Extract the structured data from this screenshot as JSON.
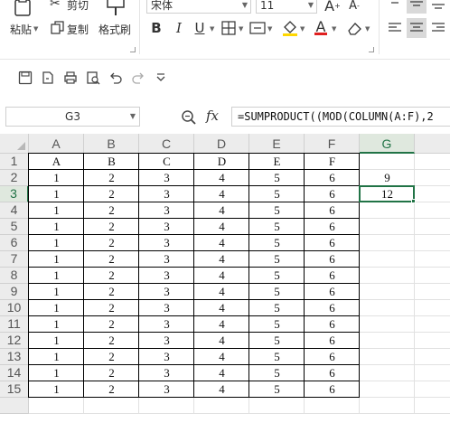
{
  "ribbon": {
    "paste_label": "粘贴",
    "cut_label": "剪切",
    "copy_label": "复制",
    "format_painter_label": "格式刷",
    "font_name": "宋体",
    "font_size": "11",
    "increase_font_label": "A",
    "decrease_font_label": "A",
    "bold_label": "B",
    "italic_label": "I",
    "underline_label": "U",
    "font_color_label": "A",
    "font_color": "#e02020",
    "fill_color": "#ffd700"
  },
  "formula_bar": {
    "name_box": "G3",
    "fx_label": "fx",
    "formula": "=SUMPRODUCT((MOD(COLUMN(A:F),2"
  },
  "columns": [
    "A",
    "B",
    "C",
    "D",
    "E",
    "F",
    "G"
  ],
  "rows": [
    "1",
    "2",
    "3",
    "4",
    "5",
    "6",
    "7",
    "8",
    "9",
    "10",
    "11",
    "12",
    "13",
    "14",
    "15",
    ""
  ],
  "header_row": [
    "A",
    "B",
    "C",
    "D",
    "E",
    "F"
  ],
  "data_row": [
    "1",
    "2",
    "3",
    "4",
    "5",
    "6"
  ],
  "g_values": {
    "row2": "9",
    "row3": "12"
  },
  "selected_cell": "G3",
  "accent_color": "#217346"
}
